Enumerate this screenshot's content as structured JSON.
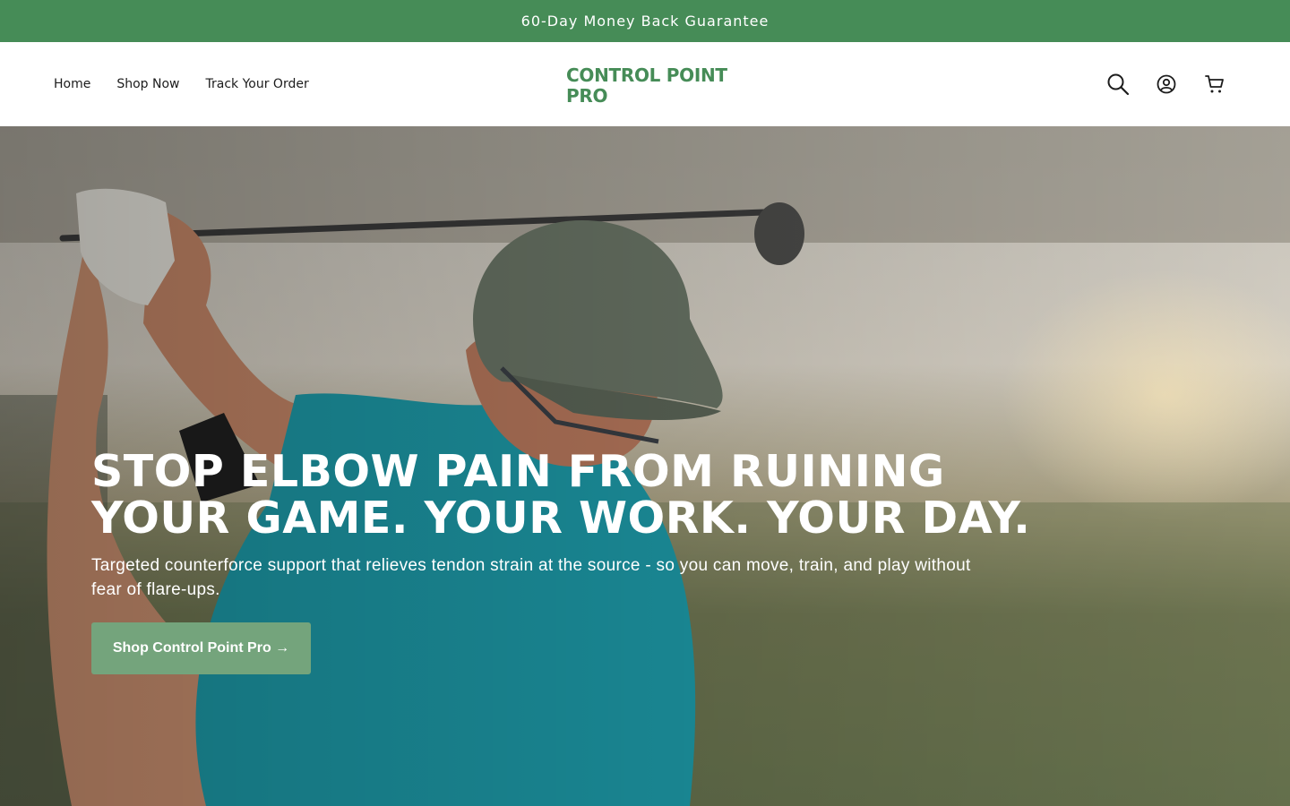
{
  "announcement": {
    "text": "60-Day Money Back Guarantee"
  },
  "colors": {
    "brand": "#468c57",
    "button": "#74a47c"
  },
  "nav": {
    "items": [
      {
        "label": "Home"
      },
      {
        "label": "Shop Now"
      },
      {
        "label": "Track Your Order"
      }
    ]
  },
  "logo": {
    "line1": "CONTROL POINT",
    "line2": "PRO"
  },
  "header_icons": [
    "search-icon",
    "account-icon",
    "cart-icon"
  ],
  "hero": {
    "title_line1": "STOP ELBOW PAIN FROM RUINING",
    "title_line2": "YOUR GAME. YOUR WORK. YOUR DAY.",
    "subtitle": "Targeted counterforce support that relieves tendon strain at the source - so you can move, train, and play without fear of flare-ups.",
    "cta_label": "Shop Control Point Pro →"
  }
}
